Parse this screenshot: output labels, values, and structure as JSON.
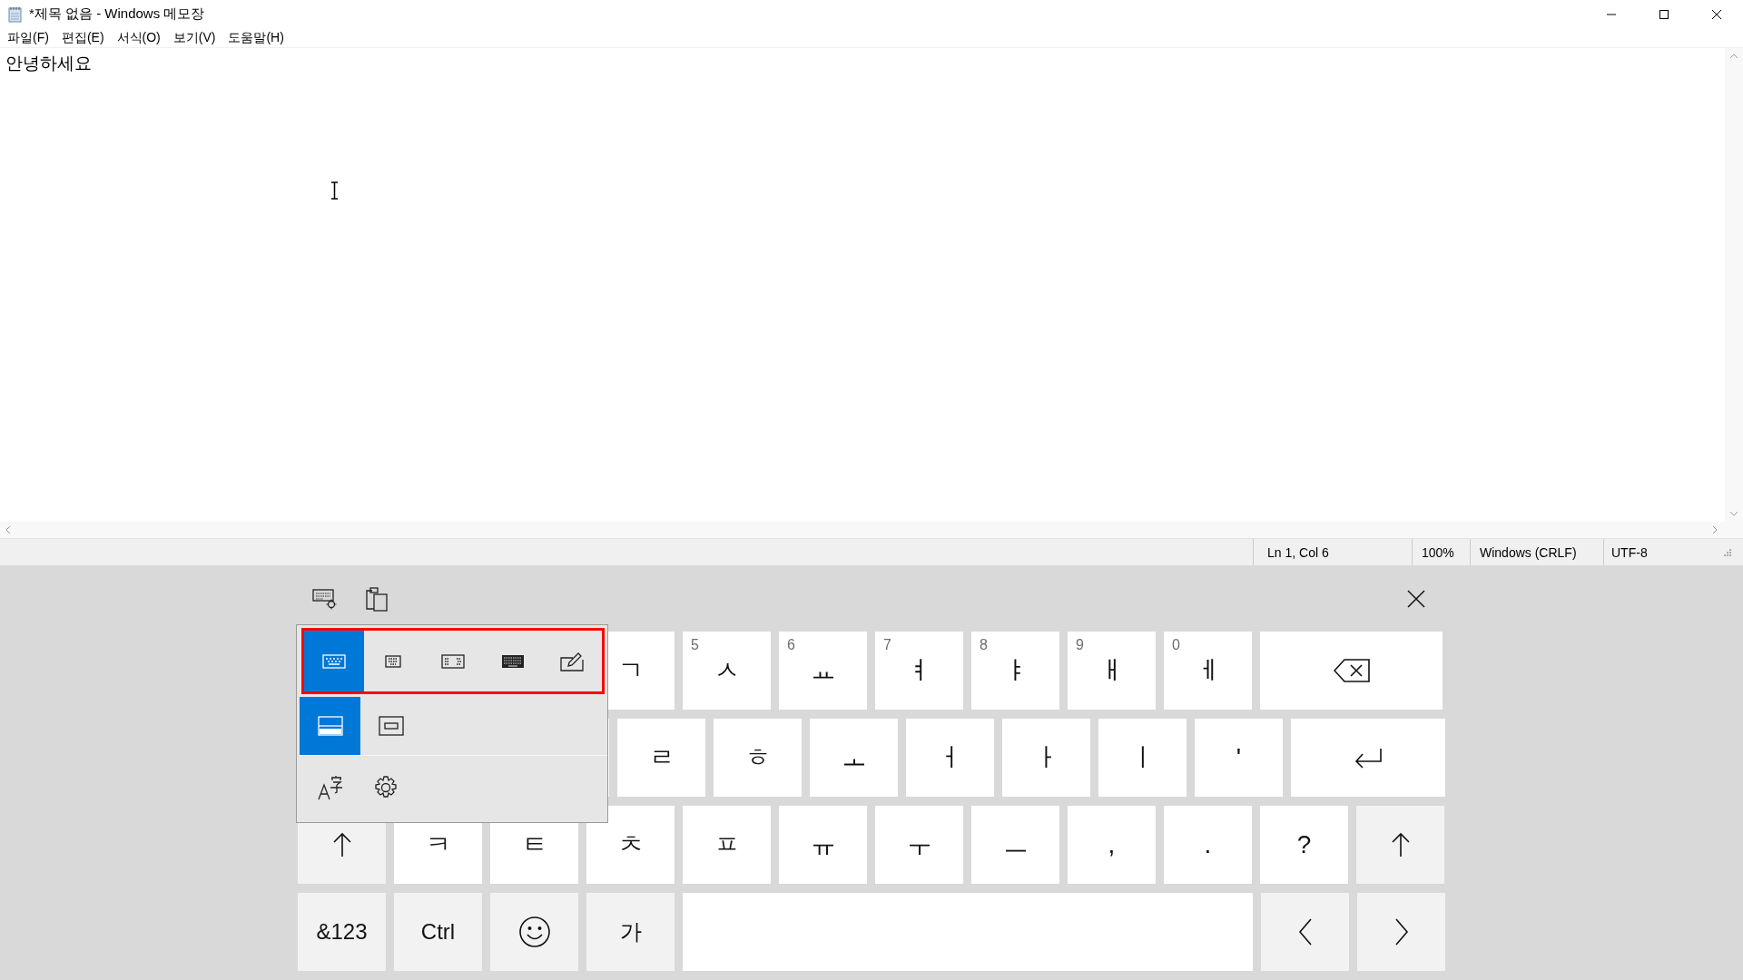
{
  "window": {
    "title": "*제목 없음 - Windows 메모장"
  },
  "menu": [
    "파일(F)",
    "편집(E)",
    "서식(O)",
    "보기(V)",
    "도움말(H)"
  ],
  "document": {
    "text": "안녕하세요"
  },
  "status_bar": [
    "Ln 1, Col 6",
    "100%",
    "Windows (CRLF)",
    "UTF-8"
  ],
  "touch_keyboard": {
    "layout_menu": {
      "layouts": [
        {
          "kind": "default",
          "selected": true
        },
        {
          "kind": "small",
          "selected": false
        },
        {
          "kind": "split",
          "selected": false
        },
        {
          "kind": "full",
          "selected": false
        },
        {
          "kind": "handwriting",
          "selected": false
        }
      ],
      "docking": [
        {
          "kind": "docked",
          "selected": true
        },
        {
          "kind": "floating",
          "selected": false
        }
      ]
    },
    "rows": [
      [
        "",
        "",
        "",
        {
          "kind": "char",
          "label": "ㄱ"
        },
        {
          "kind": "char",
          "label": "ㅅ",
          "hint": "5"
        },
        {
          "kind": "char",
          "label": "ㅛ",
          "hint": "6"
        },
        {
          "kind": "char",
          "label": "ㅕ",
          "hint": "7"
        },
        {
          "kind": "char",
          "label": "ㅑ",
          "hint": "8"
        },
        {
          "kind": "char",
          "label": "ㅐ",
          "hint": "9"
        },
        {
          "kind": "char",
          "label": "ㅔ",
          "hint": "0"
        },
        {
          "kind": "backspace"
        }
      ],
      [
        "",
        "",
        "",
        {
          "kind": "char",
          "label": "ㄹ"
        },
        {
          "kind": "char",
          "label": "ㅎ"
        },
        {
          "kind": "char",
          "label": "ㅗ"
        },
        {
          "kind": "char",
          "label": "ㅓ"
        },
        {
          "kind": "char",
          "label": "ㅏ"
        },
        {
          "kind": "char",
          "label": "ㅣ"
        },
        {
          "kind": "char",
          "label": "'"
        },
        {
          "kind": "enter"
        }
      ],
      [
        {
          "kind": "shift"
        },
        {
          "kind": "char",
          "label": "ㅋ"
        },
        {
          "kind": "char",
          "label": "ㅌ"
        },
        {
          "kind": "char",
          "label": "ㅊ"
        },
        {
          "kind": "char",
          "label": "ㅍ"
        },
        {
          "kind": "char",
          "label": "ㅠ"
        },
        {
          "kind": "char",
          "label": "ㅜ"
        },
        {
          "kind": "char",
          "label": "ㅡ"
        },
        {
          "kind": "char",
          "label": ","
        },
        {
          "kind": "char",
          "label": "."
        },
        {
          "kind": "char",
          "label": "?"
        },
        {
          "kind": "shift"
        }
      ],
      [
        {
          "kind": "mod",
          "label": "&123"
        },
        {
          "kind": "mod",
          "label": "Ctrl"
        },
        {
          "kind": "emoji"
        },
        {
          "kind": "mod",
          "label": "가"
        },
        {
          "kind": "space"
        },
        {
          "kind": "left"
        },
        {
          "kind": "right"
        }
      ]
    ]
  }
}
